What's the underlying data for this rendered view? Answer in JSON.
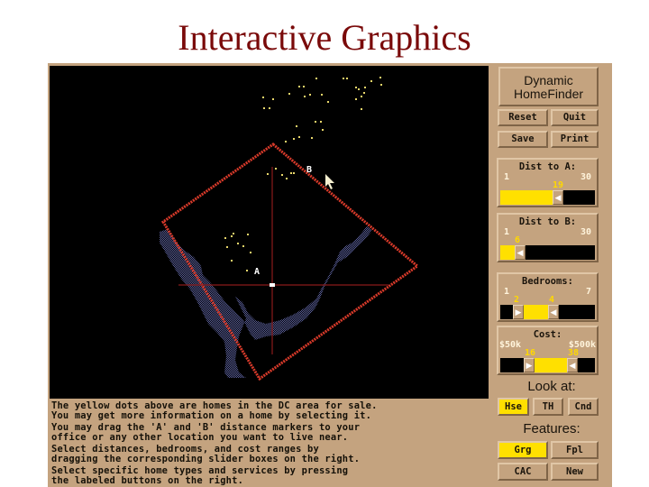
{
  "slide": {
    "title": "Interactive Graphics"
  },
  "app": {
    "title_line1": "Dynamic",
    "title_line2": "HomeFinder",
    "buttons": {
      "reset": "Reset",
      "quit": "Quit",
      "save": "Save",
      "print": "Print"
    },
    "sliders": {
      "dist_a": {
        "title": "Dist to A:",
        "min_label": "1",
        "max_label": "30",
        "min": 1,
        "max": 30,
        "value": 19,
        "value_label": "19"
      },
      "dist_b": {
        "title": "Dist to B:",
        "min_label": "1",
        "max_label": "30",
        "min": 1,
        "max": 30,
        "value": 6,
        "value_label": "6"
      },
      "bedrooms": {
        "title": "Bedrooms:",
        "min_label": "1",
        "max_label": "7",
        "min": 1,
        "max": 7,
        "low": 2,
        "high": 4,
        "low_label": "2",
        "high_label": "4"
      },
      "cost": {
        "title": "Cost:",
        "min_label": "$50k",
        "max_label": "$500k",
        "min": 0,
        "max": 50,
        "low": 16,
        "high": 38,
        "low_label": "16",
        "high_label": "38"
      }
    },
    "look_at": {
      "label": "Look at:",
      "options": [
        {
          "label": "Hse",
          "selected": true
        },
        {
          "label": "TH",
          "selected": false
        },
        {
          "label": "Cnd",
          "selected": false
        }
      ]
    },
    "features": {
      "label": "Features:",
      "options": [
        {
          "label": "Grg",
          "selected": true
        },
        {
          "label": "Fpl",
          "selected": false
        },
        {
          "label": "CAC",
          "selected": false
        },
        {
          "label": "New",
          "selected": false
        }
      ]
    },
    "map": {
      "marker_a": "A",
      "marker_b": "B",
      "colors": {
        "background": "#000000",
        "boundary": "#d83a2a",
        "river": "#4a4f86",
        "homes": "#e8d66a",
        "crosshair": "#8a1a1a"
      }
    },
    "info_lines": [
      [
        "The yellow dots above are homes in the DC area for sale.",
        "You may get more information on a home by selecting it."
      ],
      [
        "You may drag the 'A' and 'B' distance markers to your",
        "office or any other location you want to live near."
      ],
      [
        "Select distances, bedrooms, and cost ranges by",
        "dragging the corresponding slider boxes on the right."
      ],
      [
        "Select specific home types and services by pressing",
        "the labeled buttons on the right."
      ]
    ]
  }
}
